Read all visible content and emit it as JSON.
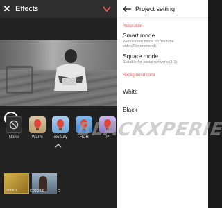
{
  "left": {
    "title": "Effects",
    "filters": [
      {
        "label": "None",
        "icon": "slash-circle-icon"
      },
      {
        "label": "Warm",
        "icon": "balloon-icon"
      },
      {
        "label": "Beauty",
        "icon": "balloon-icon"
      },
      {
        "label": "HDR",
        "icon": "balloon-icon"
      },
      {
        "label": "P",
        "icon": "balloon-icon"
      }
    ],
    "clips": [
      {
        "time": "00:06.1",
        "tag": "C"
      },
      {
        "time": "00:28.0",
        "tag": "C"
      }
    ]
  },
  "right": {
    "title": "Project setting",
    "resolution_header": "Resolution",
    "smart_mode_title": "Smart mode",
    "smart_mode_desc": "Widescreen mode for Youtube video(Recommend)",
    "square_mode_title": "Square mode",
    "square_mode_desc": "Suitable for social networks(1:1)",
    "bg_header": "Background color",
    "white_label": "White",
    "black_label": "Black"
  },
  "watermark": "BLACKXPERIENCE",
  "colors": {
    "accent": "#e45b58",
    "check": "#e45b58"
  }
}
